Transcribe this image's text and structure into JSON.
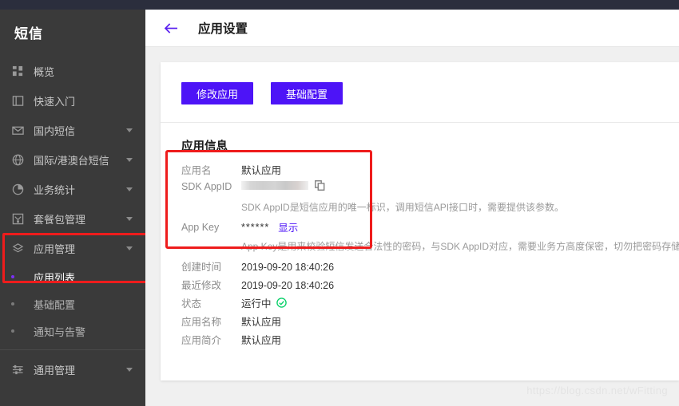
{
  "window": {
    "top_bar_color": "#2b2e3d"
  },
  "sidebar": {
    "title": "短信",
    "items": [
      {
        "label": "概览",
        "icon": "grid-icon",
        "expandable": false
      },
      {
        "label": "快速入门",
        "icon": "book-icon",
        "expandable": false
      },
      {
        "label": "国内短信",
        "icon": "envelope-icon",
        "expandable": true
      },
      {
        "label": "国际/港澳台短信",
        "icon": "globe-icon",
        "expandable": true
      },
      {
        "label": "业务统计",
        "icon": "pie-chart-icon",
        "expandable": true
      },
      {
        "label": "套餐包管理",
        "icon": "package-icon",
        "expandable": true
      },
      {
        "label": "应用管理",
        "icon": "layers-icon",
        "expandable": true
      }
    ],
    "sub_items": [
      {
        "label": "应用列表",
        "active": true
      },
      {
        "label": "基础配置",
        "active": false
      },
      {
        "label": "通知与告警",
        "active": false
      }
    ],
    "footer_item": {
      "label": "通用管理",
      "icon": "sliders-icon",
      "expandable": true
    },
    "highlight_color": "#ee1c1c"
  },
  "header": {
    "back_icon": "back-arrow-icon",
    "title": "应用设置"
  },
  "toolbar": {
    "edit_app_label": "修改应用",
    "basic_config_label": "基础配置",
    "button_color": "#4d14f7"
  },
  "app_info": {
    "section_title": "应用信息",
    "rows": [
      {
        "label": "应用名",
        "value": "默认应用"
      },
      {
        "label": "SDK AppID",
        "value": "",
        "masked": true,
        "copy_icon": "copy-icon"
      },
      {
        "label": "App Key",
        "value": "******",
        "link": "显示"
      },
      {
        "label": "创建时间",
        "value": "2019-09-20 18:40:26"
      },
      {
        "label": "最近修改",
        "value": "2019-09-20 18:40:26"
      },
      {
        "label": "状态",
        "value": "运行中",
        "status": true,
        "status_color": "#0ad06a",
        "status_icon": "check-circle-icon"
      },
      {
        "label": "应用名称",
        "value": "默认应用"
      },
      {
        "label": "应用简介",
        "value": "默认应用"
      }
    ],
    "sdk_appid_hint": "SDK AppID是短信应用的唯一标识，调用短信API接口时，需要提供该参数。",
    "app_key_hint": "App Key是用来校验短信发送合法性的密码，与SDK AppID对应，需要业务方高度保密，切勿把密码存储在",
    "highlight_color": "#ee1c1c"
  },
  "watermark": {
    "text": "https://blog.csdn.net/wFitting"
  }
}
